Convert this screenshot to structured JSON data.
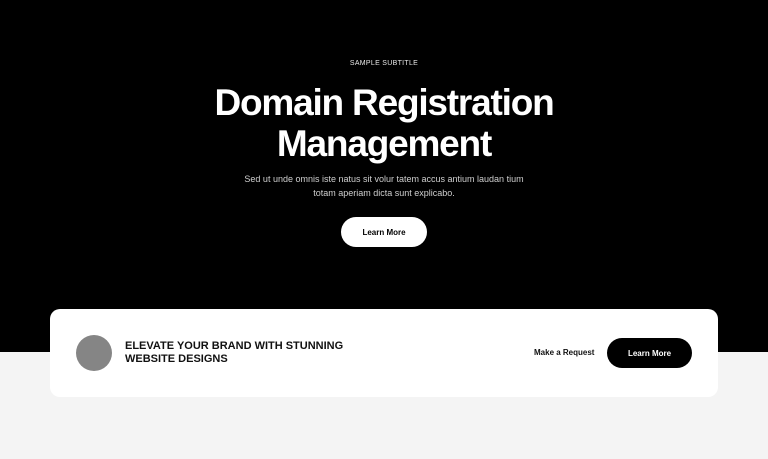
{
  "hero": {
    "subtitle": "SAMPLE SUBTITLE",
    "title_line1": "Domain Registration",
    "title_line2": "Management",
    "description": "Sed ut unde omnis iste natus sit volur tatem accus antium laudan tium totam aperiam dicta sunt explicabo.",
    "button_label": "Learn More"
  },
  "cta_card": {
    "heading_line1": "ELEVATE YOUR BRAND WITH STUNNING",
    "heading_line2": "WEBSITE DESIGNS",
    "request_link": "Make a Request",
    "button_label": "Learn More"
  },
  "colors": {
    "hero_background": "#000000",
    "page_background": "#f4f4f4",
    "card_background": "#ffffff",
    "avatar": "#858585"
  }
}
